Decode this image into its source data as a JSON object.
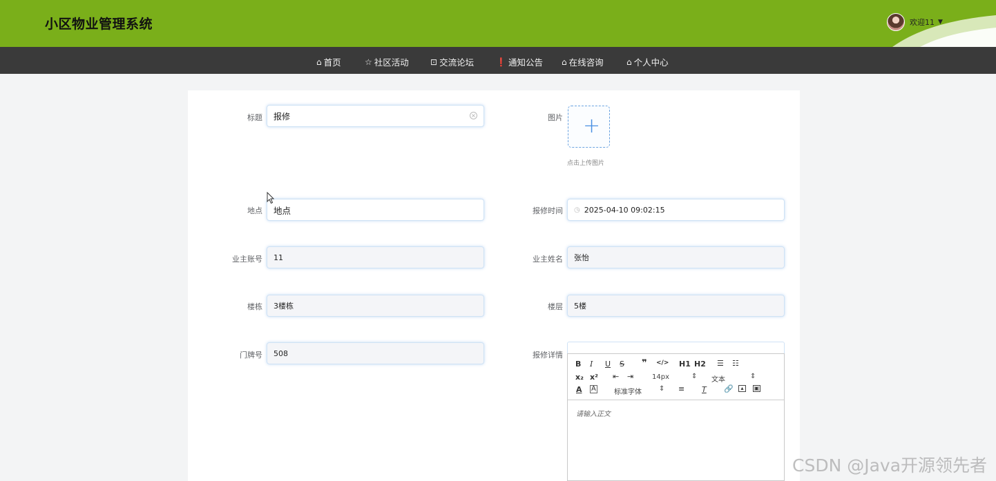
{
  "header": {
    "app_title": "小区物业管理系统",
    "welcome": "欢迎11",
    "avatar_icon": "user-avatar",
    "caret_icon": "caret-down-icon",
    "accent_color": "#7aaf1a"
  },
  "nav": {
    "items": [
      {
        "label": "首页",
        "icon": "home-icon"
      },
      {
        "label": "社区活动",
        "icon": "star-icon"
      },
      {
        "label": "交流论坛",
        "icon": "bag-icon"
      },
      {
        "label": "通知公告",
        "icon": "info-icon"
      },
      {
        "label": "在线咨询",
        "icon": "home-icon"
      },
      {
        "label": "个人中心",
        "icon": "home-icon"
      }
    ]
  },
  "form": {
    "title": {
      "label": "标题",
      "value": "报修"
    },
    "image": {
      "label": "图片",
      "hint": "点击上传图片"
    },
    "location": {
      "label": "地点",
      "value": "地点"
    },
    "repair_time": {
      "label": "报修时间",
      "value": "2025-04-10 09:02:15"
    },
    "owner_account": {
      "label": "业主账号",
      "value": "11"
    },
    "owner_name": {
      "label": "业主姓名",
      "value": "张怡"
    },
    "building": {
      "label": "楼栋",
      "value": "3楼栋"
    },
    "floor": {
      "label": "楼层",
      "value": "5楼"
    },
    "door_number": {
      "label": "门牌号",
      "value": "508"
    },
    "details": {
      "label": "报修详情",
      "placeholder": "请输入正文"
    }
  },
  "editor_toolbar": {
    "font_size": "14px",
    "text_type": "文本",
    "font_family": "标准字体",
    "h1": "H1",
    "h2": "H2"
  },
  "watermark": "CSDN @Java开源领先者"
}
